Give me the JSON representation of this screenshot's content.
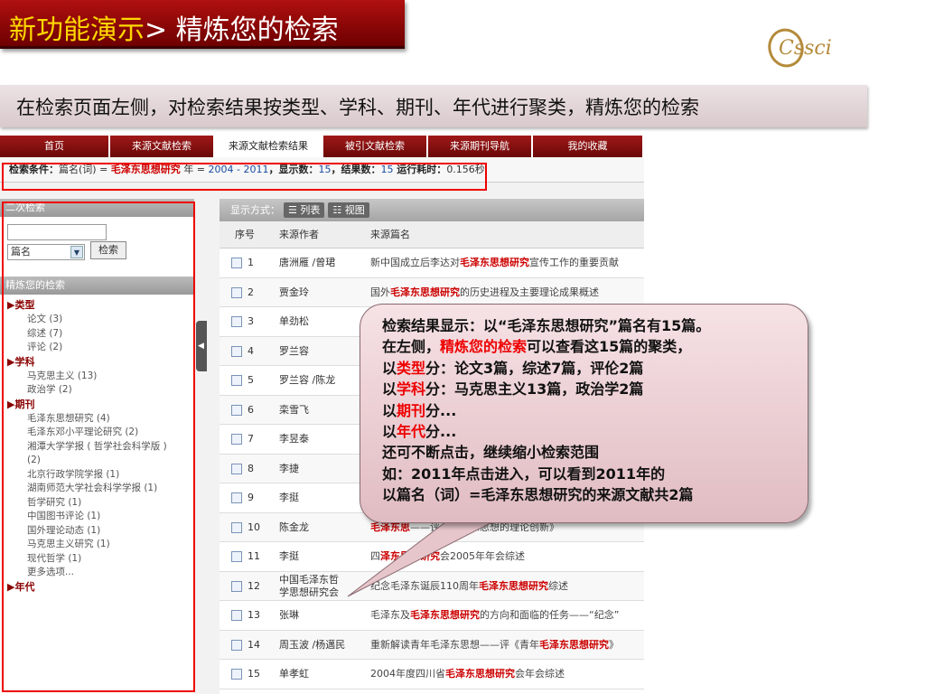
{
  "banner": {
    "prefix": "新功能演示",
    "suffix": "> 精炼您的检索"
  },
  "logo": {
    "text": "Cssci"
  },
  "subtitle": "在检索页面左侧，对检索结果按类型、学科、期刊、年代进行聚类，精炼您的检索",
  "nav": {
    "tabs": [
      "首页",
      "来源文献检索",
      "来源文献检索结果",
      "被引文献检索",
      "来源期刊导航",
      "我的收藏"
    ],
    "active_index": 2
  },
  "conditions": {
    "label": "检索条件：",
    "field": "篇名(词) = ",
    "term": "毛泽东思想研究",
    "year_label": " 年 = ",
    "year_range": "2004 - 2011",
    "shown_label": "，显示数：",
    "shown": "15",
    "results_label": "，结果数：",
    "results": "15",
    "time_label": "  运行耗时：",
    "time": "0.156秒"
  },
  "sidebar": {
    "secondary_search": "二次检索",
    "select_value": "篇名",
    "search_button": "检索",
    "refine_header": "精炼您的检索",
    "facets": [
      {
        "title": "▶类型",
        "items": [
          "论文 (3)",
          "综述 (7)",
          "评论 (2)"
        ]
      },
      {
        "title": "▶学科",
        "items": [
          "马克思主义 (13)",
          "政治学 (2)"
        ]
      },
      {
        "title": "▶期刊",
        "items": [
          "毛泽东思想研究 (4)",
          "毛泽东邓小平理论研究 (2)",
          "湘潭大学学报 ( 哲学社会科学版 )",
          "(2)",
          "北京行政学院学报 (1)",
          "湖南师范大学社会科学学报 (1)",
          "哲学研究 (1)",
          "中国图书评论 (1)",
          "国外理论动态 (1)",
          "马克思主义研究 (1)",
          "现代哲学 (1)",
          "更多选项..."
        ]
      },
      {
        "title": "▶年代",
        "items": []
      }
    ]
  },
  "main": {
    "display_label": "显示方式：",
    "list_btn": "☰ 列表",
    "view_btn": "☷ 视图",
    "headers": {
      "no": "序号",
      "author": "来源作者",
      "title": "来源篇名"
    },
    "rows": [
      {
        "no": "1",
        "author": "唐洲雁 /曾珺",
        "pre": "新中国成立后李达对",
        "hl": "毛泽东思想研究",
        "post": "宣传工作的重要贡献"
      },
      {
        "no": "2",
        "author": "贾金玲",
        "pre": "国外",
        "hl": "毛泽东思想研究",
        "post": "的历史进程及主要理论成果概述"
      },
      {
        "no": "3",
        "author": "单劲松",
        "pre": "",
        "hl": "",
        "post": ""
      },
      {
        "no": "4",
        "author": "罗兰容",
        "pre": "",
        "hl": "",
        "post": ""
      },
      {
        "no": "5",
        "author": "罗兰容 /陈龙",
        "pre": "",
        "hl": "",
        "post": ""
      },
      {
        "no": "6",
        "author": "栾雪飞",
        "pre": "",
        "hl": "",
        "post": ""
      },
      {
        "no": "7",
        "author": "李昱泰",
        "pre": "",
        "hl": "",
        "post": ""
      },
      {
        "no": "8",
        "author": "李捷",
        "pre": "",
        "hl": "",
        "post": ""
      },
      {
        "no": "9",
        "author": "李挺",
        "pre": "",
        "hl": "",
        "post": ""
      },
      {
        "no": "10",
        "author": "陈金龙",
        "pre": "",
        "hl": "毛泽东思",
        "post": "——评《毛泽东思想的理论创新》"
      },
      {
        "no": "11",
        "author": "李挺",
        "pre": "四",
        "hl": "泽东思想研究",
        "post": "会2005年年会综述"
      },
      {
        "no": "12",
        "author": "中国毛泽东哲学思想研究会",
        "pre": "纪念毛泽东诞辰110周年",
        "hl": "毛泽东思想研究",
        "post": "综述"
      },
      {
        "no": "13",
        "author": "张琳",
        "pre": "毛泽东及",
        "hl": "毛泽东思想研究",
        "post": "的方向和面临的任务——“纪念”"
      },
      {
        "no": "14",
        "author": "周玉波 /杨邁民",
        "pre": "重新解读青年毛泽东思想——评《青年",
        "hl": "毛泽东思想研究",
        "post": "》"
      },
      {
        "no": "15",
        "author": "单孝虹",
        "pre": "2004年度四川省",
        "hl": "毛泽东思想研究",
        "post": "会年会综述"
      }
    ]
  },
  "callout": {
    "lines": [
      [
        {
          "t": "检索结果显示：以“毛泽东思想研究”篇名有15篇。",
          "r": false
        }
      ],
      [
        {
          "t": "在左侧，",
          "r": false
        },
        {
          "t": "精炼您的检索",
          "r": true
        },
        {
          "t": "可以查看这15篇的聚类，",
          "r": false
        }
      ],
      [
        {
          "t": "以",
          "r": false
        },
        {
          "t": "类型",
          "r": true
        },
        {
          "t": "分：论文3篇，综述7篇，评伦2篇",
          "r": false
        }
      ],
      [
        {
          "t": "以",
          "r": false
        },
        {
          "t": "学科",
          "r": true
        },
        {
          "t": "分：马克思主义13篇，政治学2篇",
          "r": false
        }
      ],
      [
        {
          "t": "以",
          "r": false
        },
        {
          "t": "期刊",
          "r": true
        },
        {
          "t": "分...",
          "r": false
        }
      ],
      [
        {
          "t": "以",
          "r": false
        },
        {
          "t": "年代",
          "r": true
        },
        {
          "t": "分...",
          "r": false
        }
      ],
      [
        {
          "t": "还可不断点击，继续缩小检索范围",
          "r": false
        }
      ],
      [
        {
          "t": "如：2011年点击进入，可以看到2011年的",
          "r": false
        }
      ],
      [
        {
          "t": "以篇名（词）=毛泽东思想研究的来源文献共2篇",
          "r": false
        }
      ]
    ]
  },
  "colors": {
    "brand_red": "#8a0000",
    "highlight_red": "#cc0000",
    "box_red": "#ee0000"
  }
}
